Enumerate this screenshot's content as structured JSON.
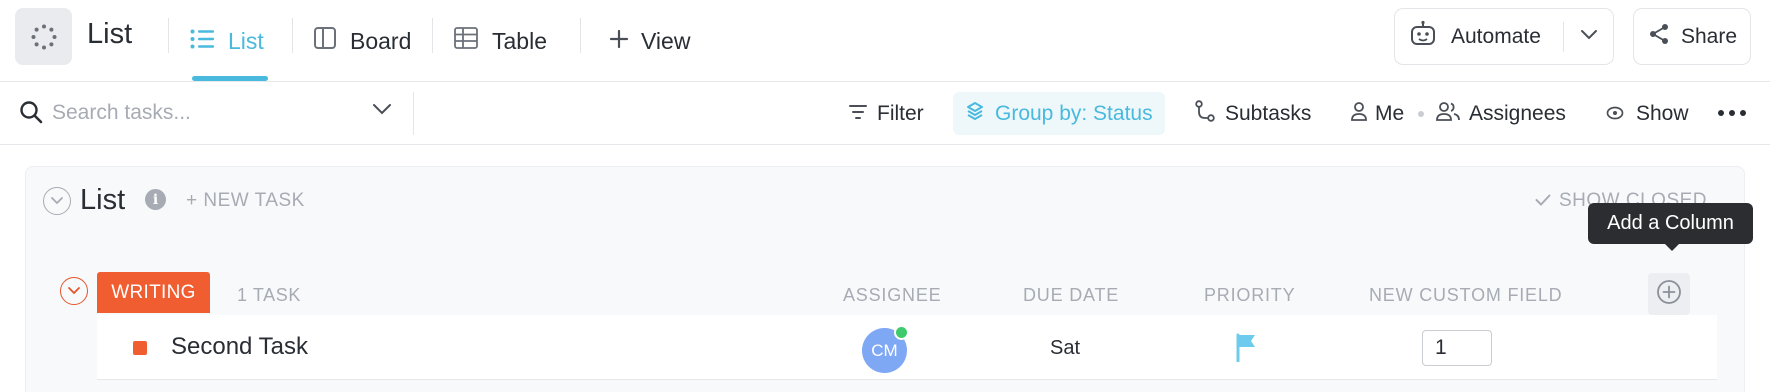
{
  "header": {
    "title": "List",
    "tabs": [
      {
        "label": "List",
        "icon": "list-icon",
        "active": true
      },
      {
        "label": "Board",
        "icon": "board-icon",
        "active": false
      },
      {
        "label": "Table",
        "icon": "table-icon",
        "active": false
      }
    ],
    "add_view_label": "View",
    "automate_label": "Automate",
    "share_label": "Share",
    "accent_color": "#49b9dd"
  },
  "toolbar": {
    "search_placeholder": "Search tasks...",
    "filter_label": "Filter",
    "group_by_label": "Group by: Status",
    "subtasks_label": "Subtasks",
    "me_label": "Me",
    "assignees_label": "Assignees",
    "show_label": "Show"
  },
  "list": {
    "title": "List",
    "new_task_label": "+ NEW TASK",
    "show_closed_label": "SHOW CLOSED",
    "tooltip": "Add a Column",
    "group": {
      "status": "WRITING",
      "status_color": "#ef5d30",
      "task_count": "1 TASK",
      "columns": {
        "assignee": "ASSIGNEE",
        "due_date": "DUE DATE",
        "priority": "PRIORITY",
        "custom_field": "NEW CUSTOM FIELD"
      },
      "tasks": [
        {
          "name": "Second Task",
          "assignee_initials": "CM",
          "due": "Sat",
          "priority_color": "#6fcbee",
          "custom_value": "1"
        }
      ]
    }
  }
}
